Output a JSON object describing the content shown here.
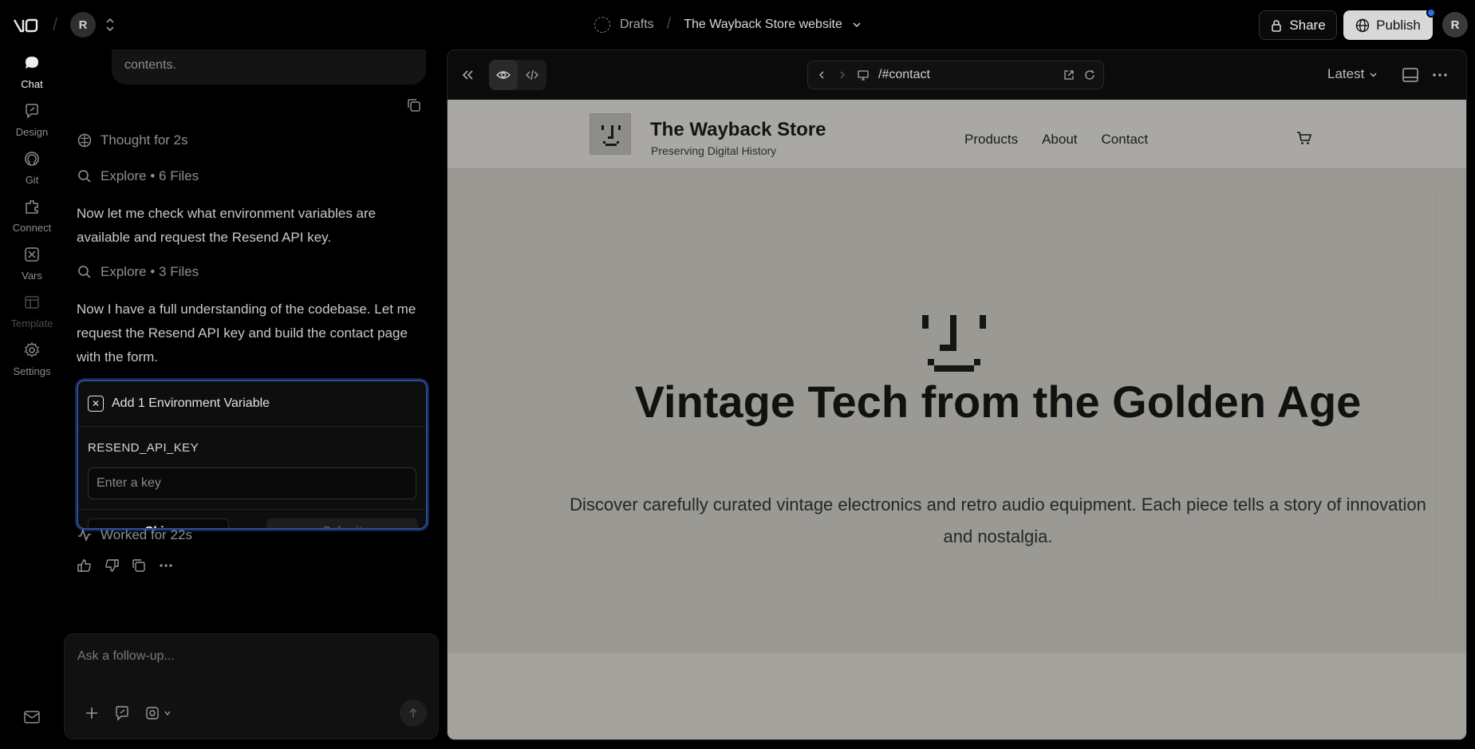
{
  "topbar": {
    "project_initial": "R",
    "drafts_label": "Drafts",
    "project_name": "The Wayback Store website",
    "share_label": "Share",
    "publish_label": "Publish",
    "user_initial": "R"
  },
  "rail": {
    "items": [
      {
        "label": "Chat",
        "icon": "chat-icon"
      },
      {
        "label": "Design",
        "icon": "design-icon"
      },
      {
        "label": "Git",
        "icon": "github-icon"
      },
      {
        "label": "Connect",
        "icon": "connect-icon"
      },
      {
        "label": "Vars",
        "icon": "vars-icon"
      },
      {
        "label": "Template",
        "icon": "template-icon"
      },
      {
        "label": "Settings",
        "icon": "gear-icon"
      }
    ]
  },
  "chat": {
    "previous_tail": "contents.",
    "thought": "Thought for 2s",
    "explore1": "Explore • 6 Files",
    "para1": "Now let me check what environment variables are available and request the Resend API key.",
    "explore2": "Explore • 3 Files",
    "para2": "Now I have a full understanding of the codebase. Let me request the Resend API key and build the contact page with the form.",
    "env_card": {
      "title": "Add 1 Environment Variable",
      "var_name": "RESEND_API_KEY",
      "input_placeholder": "Enter a key",
      "input_value": "",
      "skip_label": "Skip",
      "submit_label": "Submit"
    },
    "worked": "Worked for 22s",
    "composer_placeholder": "Ask a follow-up..."
  },
  "preview": {
    "url": "/#contact",
    "version_label": "Latest",
    "site": {
      "title": "The Wayback Store",
      "tagline": "Preserving Digital History",
      "nav": [
        "Products",
        "About",
        "Contact"
      ],
      "hero_title": "Vintage Tech from the Golden Age",
      "hero_subtitle": "Discover carefully curated vintage electronics and retro audio equipment. Each piece tells a story of innovation and nostalgia."
    }
  },
  "colors": {
    "accent_blue": "#2f6feb",
    "env_card_border": "#2b4a9a",
    "site_overlay_bg": "#9b9a95"
  }
}
